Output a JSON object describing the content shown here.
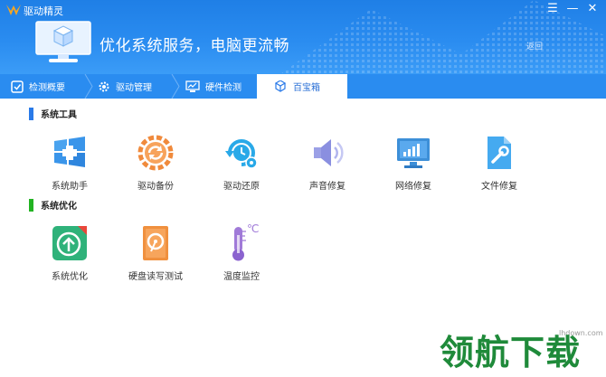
{
  "app": {
    "title": "驱动精灵"
  },
  "window_controls": [
    {
      "name": "menu-icon",
      "glyph": "☰"
    },
    {
      "name": "minimize-icon",
      "glyph": "—"
    },
    {
      "name": "close-icon",
      "glyph": "✕"
    }
  ],
  "hero": {
    "slogan": "优化系统服务，电脑更流畅",
    "back_label": "返回"
  },
  "tabs": [
    {
      "label": "检测概要",
      "icon": "check-summary-icon"
    },
    {
      "label": "驱动管理",
      "icon": "gear-icon"
    },
    {
      "label": "硬件检测",
      "icon": "monitor-chart-icon"
    },
    {
      "label": "百宝箱",
      "icon": "toolbox-icon",
      "active": true
    }
  ],
  "sections": [
    {
      "title": "系统工具",
      "color": "#2a7ae8",
      "tools": [
        {
          "label": "系统助手",
          "icon": "windows-plus-icon"
        },
        {
          "label": "驱动备份",
          "icon": "backup-gear-icon"
        },
        {
          "label": "驱动还原",
          "icon": "restore-clock-icon"
        },
        {
          "label": "声音修复",
          "icon": "speaker-icon"
        },
        {
          "label": "网络修复",
          "icon": "network-monitor-icon"
        },
        {
          "label": "文件修复",
          "icon": "file-wrench-icon"
        }
      ]
    },
    {
      "title": "系统优化",
      "color": "#22b322",
      "tools": [
        {
          "label": "系统优化",
          "icon": "rocket-optimize-icon",
          "badge": "N"
        },
        {
          "label": "硬盘读写测试",
          "icon": "harddisk-icon"
        },
        {
          "label": "温度监控",
          "icon": "thermometer-icon",
          "unit": "℃"
        }
      ]
    }
  ],
  "watermark": {
    "site": "lhdown.com",
    "brand": "领航下载"
  }
}
